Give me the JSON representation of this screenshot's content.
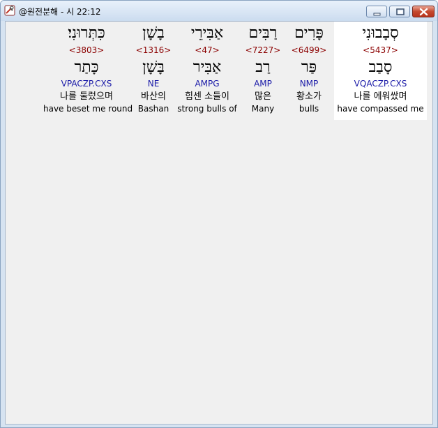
{
  "window": {
    "title": "@원전분해 - 시 22:12",
    "icon": "tools-app-icon",
    "controls": [
      "minimize",
      "maximize",
      "close"
    ]
  },
  "words": [
    {
      "id": "w1",
      "hebrew": "כִּתְּרוּנִי׃",
      "strongs": "<3803>",
      "lemma": "כָּתַר",
      "morph": "VPACZP.CXS",
      "korean": "나를 둘렀으며",
      "english": "have beset me round",
      "selected": false
    },
    {
      "id": "w2",
      "hebrew": "בָשָׁן",
      "strongs": "<1316>",
      "lemma": "בָּשָׁן",
      "morph": "NE",
      "korean": "바산의",
      "english": "Bashan",
      "selected": false
    },
    {
      "id": "w3",
      "hebrew": "אַבִּירֵי",
      "strongs": "<47>",
      "lemma": "אַבִּיר",
      "morph": "AMPG",
      "korean": "힘센 소들이",
      "english": "strong bulls of",
      "selected": false
    },
    {
      "id": "w4",
      "hebrew": "רַבִּים",
      "strongs": "<7227>",
      "lemma": "רַב",
      "morph": "AMP",
      "korean": "많은",
      "english": "Many",
      "selected": false
    },
    {
      "id": "w5",
      "hebrew": "פָּרִים",
      "strongs": "<6499>",
      "lemma": "פַּר",
      "morph": "NMP",
      "korean": "황소가",
      "english": "bulls",
      "selected": false
    },
    {
      "id": "w6",
      "hebrew": "סְבָבוּנִי",
      "strongs": "<5437>",
      "lemma": "סָבַב",
      "morph": "VQACZP.CXS",
      "korean": "나를 에워쌌며",
      "english": "have compassed me",
      "selected": true
    }
  ]
}
